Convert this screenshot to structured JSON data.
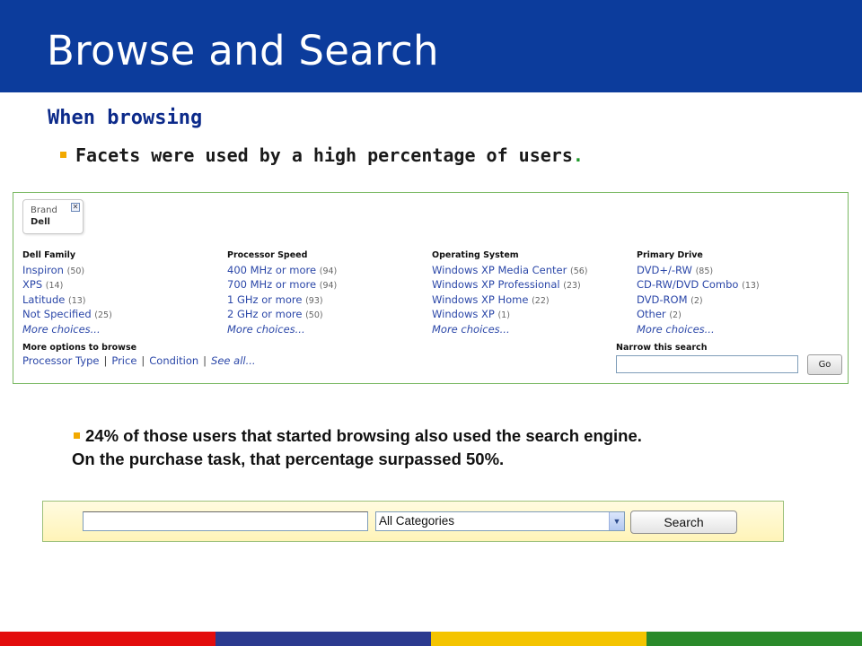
{
  "slide": {
    "title": "Browse and Search",
    "subhead": "When browsing",
    "bullet1_main": "Facets were used by a high percentage of users",
    "bullet1_end": ".",
    "para_line1": "24% of those users that started browsing also used the search engine.",
    "para_line2": "On the purchase task, that percentage surpassed 50%."
  },
  "facet_panel": {
    "brand_box": {
      "label": "Brand",
      "value": "Dell",
      "remove_glyph": "✕"
    },
    "columns": [
      {
        "header": "Dell Family",
        "items": [
          {
            "label": "Inspiron",
            "count": "(50)"
          },
          {
            "label": "XPS",
            "count": "(14)"
          },
          {
            "label": "Latitude",
            "count": "(13)"
          },
          {
            "label": "Not Specified",
            "count": "(25)"
          }
        ],
        "more": "More choices..."
      },
      {
        "header": "Processor Speed",
        "items": [
          {
            "label": "400 MHz or more",
            "count": "(94)"
          },
          {
            "label": "700 MHz or more",
            "count": "(94)"
          },
          {
            "label": "1 GHz or more",
            "count": "(93)"
          },
          {
            "label": "2 GHz or more",
            "count": "(50)"
          }
        ],
        "more": "More choices..."
      },
      {
        "header": "Operating System",
        "items": [
          {
            "label": "Windows XP Media Center",
            "count": "(56)"
          },
          {
            "label": "Windows XP Professional",
            "count": "(23)"
          },
          {
            "label": "Windows XP Home",
            "count": "(22)"
          },
          {
            "label": "Windows XP",
            "count": "(1)"
          }
        ],
        "more": "More choices..."
      },
      {
        "header": "Primary Drive",
        "items": [
          {
            "label": "DVD+/-RW",
            "count": "(85)"
          },
          {
            "label": "CD-RW/DVD Combo",
            "count": "(13)"
          },
          {
            "label": "DVD-ROM",
            "count": "(2)"
          },
          {
            "label": "Other",
            "count": "(2)"
          }
        ],
        "more": "More choices..."
      }
    ],
    "more_options": {
      "header": "More options to browse",
      "links": [
        "Processor Type",
        "Price",
        "Condition"
      ],
      "separator": "|",
      "see_all": "See all..."
    },
    "narrow": {
      "header": "Narrow this search",
      "input_value": "",
      "go_label": "Go"
    }
  },
  "search_bar": {
    "input_value": "",
    "category_selected": "All Categories",
    "arrow_glyph": "▼",
    "search_label": "Search"
  },
  "colors": {
    "title_bar": "#0c3c9c",
    "bullet_square": "#f2a900",
    "link_blue": "#2b47a8",
    "footer": [
      "#e30d0d",
      "#2b3a8f",
      "#f4c400",
      "#2a8a2a"
    ]
  },
  "icons": {
    "bullet": "square-bullet-icon",
    "remove": "close-icon",
    "dropdown": "chevron-down-icon"
  }
}
